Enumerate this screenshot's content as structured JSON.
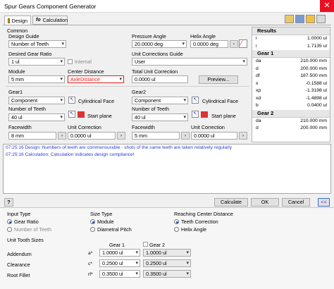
{
  "window": {
    "title": "Spur Gears Component Generator"
  },
  "tabs": [
    {
      "label": "Design"
    },
    {
      "label": "Calculation"
    }
  ],
  "common": {
    "section": "Common",
    "design_guide_label": "Design Guide",
    "design_guide_value": "Number of Teeth",
    "pressure_angle_label": "Pressure Angle",
    "pressure_angle_value": "20.0000 deg",
    "helix_angle_label": "Helix Angle",
    "helix_angle_value": "0.0000 deg",
    "desired_ratio_label": "Desired Gear Ratio",
    "desired_ratio_value": "1 ul",
    "internal_label": "Internal",
    "unit_guide_label": "Unit Corrections Guide",
    "unit_guide_value": "User",
    "module_label": "Module",
    "module_value": "5 mm",
    "center_distance_label": "Center Distance",
    "center_distance_value": "AxleDistance",
    "total_correction_label": "Total Unit Correction",
    "total_correction_value": "0.0000 ul",
    "preview_label": "Preview..."
  },
  "gear1": {
    "title": "Gear1",
    "component_value": "Component",
    "cyl_face_label": "Cylindrical Face",
    "teeth_label": "Number of Teeth",
    "teeth_value": "40 ul",
    "start_plane_label": "Start plane",
    "facewidth_label": "Facewidth",
    "facewidth_value": "8 mm",
    "correction_label": "Unit Correction",
    "correction_value": "0.0000 ul"
  },
  "gear2": {
    "title": "Gear2",
    "component_value": "Component",
    "cyl_face_label": "Cylindrical Face",
    "teeth_label": "Number of Teeth",
    "teeth_value": "40 ul",
    "start_plane_label": "Start plane",
    "facewidth_label": "Facewidth",
    "facewidth_value": "5 mm",
    "correction_label": "Unit Correction",
    "correction_value": "0.0000 ul"
  },
  "results": {
    "title": "Results",
    "top": [
      {
        "k": "i",
        "v": "1.0000 ul"
      },
      {
        "k": "i",
        "v": "1.7135 ul"
      }
    ],
    "gear1_title": "Gear 1",
    "gear1": [
      {
        "k": "da",
        "v": "210.000 mm"
      },
      {
        "k": "d",
        "v": "200.000 mm"
      },
      {
        "k": "df",
        "v": "187.500 mm"
      },
      {
        "k": "x",
        "v": "-0.1588 ul"
      },
      {
        "k": "xp",
        "v": "-1.3198 ul"
      },
      {
        "k": "xd",
        "v": "-1.4898 ul"
      },
      {
        "k": "b",
        "v": "0.0400 ul"
      }
    ],
    "gear2_title": "Gear 2",
    "gear2": [
      {
        "k": "da",
        "v": "210.000 mm"
      },
      {
        "k": "d",
        "v": "200.000 mm"
      }
    ]
  },
  "messages": [
    "07:25:16 Design: Numbers of teeth are commensurable - shots of the same teeth are taken relatively regularly",
    "07:25:16 Calculation: Calculation indicates design compliance!"
  ],
  "footer": {
    "help": "?",
    "calculate": "Calculate",
    "ok": "OK",
    "cancel": "Cancel",
    "more": "<<"
  },
  "more": {
    "input_type_label": "Input Type",
    "input_type_options": [
      "Gear Ratio",
      "Number of Teeth"
    ],
    "size_type_label": "Size Type",
    "size_type_options": [
      "Module",
      "Diametral Pitch"
    ],
    "center_label": "Reaching Center Distance",
    "center_options": [
      "Teeth Correction",
      "Helix Angle"
    ],
    "unit_sizes_label": "Unit Tooth Sizes",
    "col_gear1": "Gear 1",
    "col_gear2": "Gear 2",
    "rows": [
      {
        "label": "Addendum",
        "sym": "a*",
        "g1": "1.0000 ul",
        "g2": "1.0000 ul"
      },
      {
        "label": "Clearance",
        "sym": "c*",
        "g1": "0.2500 ul",
        "g2": "0.2500 ul"
      },
      {
        "label": "Root Fillet",
        "sym": "rf*",
        "g1": "0.3500 ul",
        "g2": "0.3500 ul"
      }
    ]
  }
}
